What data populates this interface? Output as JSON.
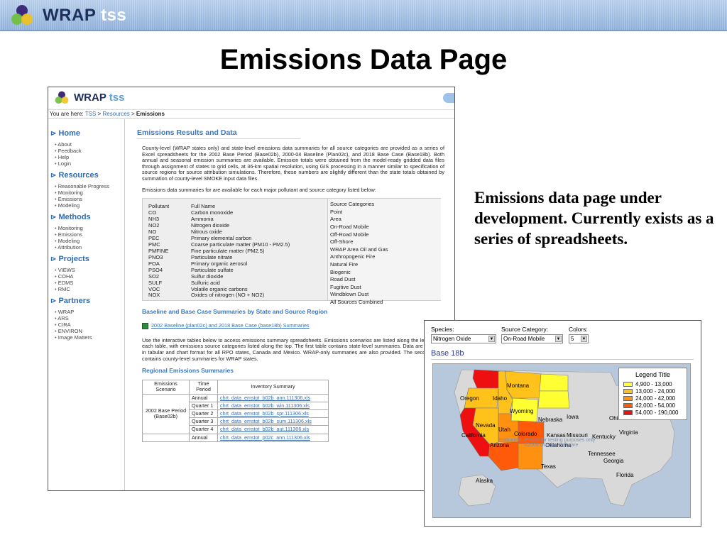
{
  "header": {
    "brand": "WRAP",
    "brand_suffix": "tss"
  },
  "slide": {
    "title": "Emissions Data Page",
    "caption": "Emissions data page under development.  Currently exists as a series of spreadsheets."
  },
  "shot1": {
    "brand": "WRAP",
    "brand_suffix": "tss",
    "breadcrumb": {
      "prefix": "You are here:",
      "items": [
        "TSS",
        "Resources"
      ],
      "current": "Emissions",
      "sep": ">"
    },
    "sidebar": [
      {
        "title": "Home",
        "items": [
          "About",
          "Feedback",
          "Help",
          "Login"
        ]
      },
      {
        "title": "Resources",
        "items": [
          "Reasonable Progress",
          "Monitoring",
          "Emissions",
          "Modeling"
        ]
      },
      {
        "title": "Methods",
        "items": [
          "Monitoring",
          "Emissions",
          "Modeling",
          "Attribution"
        ]
      },
      {
        "title": "Projects",
        "items": [
          "VIEWS",
          "COHA",
          "EDMS",
          "RMC"
        ]
      },
      {
        "title": "Partners",
        "items": [
          "WRAP",
          "ARS",
          "CIRA",
          "ENVIRON",
          "Image Matters"
        ]
      }
    ],
    "main": {
      "heading": "Emissions Results and Data",
      "para1": "County-level (WRAP states only) and state-level emissions data summaries for all source categories are provided as a series of Excel spreadsheets for the 2002 Base Period (Base02b), 2000-04 Baseline (Plan02c), and 2018 Base Case (Base18b). Both annual and seasonal emission summaries are available. Emission totals were obtained from the model-ready gridded data files through assignment of states to grid cells, at 36-km spatial resolution, using GIS processing in a manner similar to specification of source regions for source attribution simulations. Therefore, these numbers are slightly different than the state totals obtained by summation of county-level SMOKE input data files.",
      "para2": "Emissions data summaries for are available for each major pollutant and source category listed below:",
      "pollutant_header": "Pollutant",
      "fullname_header": "Full Name",
      "source_header": "Source Categories",
      "pollutants": [
        "CO",
        "NH3",
        "NO2",
        "NO",
        "PEC",
        "PMC",
        "PMFINE",
        "PNO3",
        "POA",
        "PSO4",
        "SO2",
        "SULF",
        "VOC",
        "NOX"
      ],
      "full_names": [
        "Carbon monoxide",
        "Ammonia",
        "Nitrogen dioxide",
        "Nitrous oxide",
        "Primary elemental carbon",
        "Coarse particulate matter (PM10 - PM2.5)",
        "Fine particulate matter (PM2.5)",
        "Particulate nitrate",
        "Primary organic aerosol",
        "Particulate sulfate",
        "Sulfur dioxide",
        "Sulfuric acid",
        "Volatile organic carbons",
        "Oxides of nitrogen (NO + NO2)"
      ],
      "sources": [
        "Point",
        "Area",
        "On-Road Mobile",
        "Off-Road Mobile",
        "Off-Shore",
        "WRAP Area Oil and Gas",
        "Anthropogenic Fire",
        "Natural Fire",
        "Biogenic",
        "Road Dust",
        "Fugitive Dust",
        "Windblown Dust",
        "All Sources Combined"
      ],
      "heading2": "Baseline and Base Case Summaries by State and Source Region",
      "xls_link": "2002 Baseline (plan02c) and 2018 Base Case (base18b) Summaries",
      "para3": "Use the interactive tables below to access emissions summary spreadsheets. Emissions scenarios are listed along the left side of each table, with emissions source categories listed along the top. The first table contains state-level summaries. Data are provided in tabular and chart format for all RPO states, Canada and Mexico. WRAP-only summaries are also provided. The second table contains county-level summaries for WRAP states.",
      "heading3": "Regional Emissions Summaries",
      "table": {
        "h1": "Emissions Scenario",
        "h2": "Time Period",
        "h3": "Inventory Summary",
        "scenario": "2002 Base Period (Base02b)",
        "rows": [
          {
            "period": "Annual",
            "file": "chrt_data_emstot_b02b_ann.111306.xls"
          },
          {
            "period": "Quarter 1",
            "file": "chrt_data_emstot_b02b_win.111306.xls"
          },
          {
            "period": "Quarter 2",
            "file": "chrt_data_emstot_b02b_spr.111306.xls"
          },
          {
            "period": "Quarter 3",
            "file": "chrt_data_emstot_b02b_sum.111306.xls"
          },
          {
            "period": "Quarter 4",
            "file": "chrt_data_emstot_b02b_aut.111306.xls"
          },
          {
            "period": "Annual",
            "file": "chrt_data_emstot_p02c_ann.111306.xls"
          }
        ]
      }
    }
  },
  "shot2": {
    "species_label": "Species:",
    "species_value": "Nitrogen Oxide",
    "source_label": "Source Category:",
    "source_value": "On-Road Mobile",
    "colors_label": "Colors:",
    "colors_value": "5",
    "map_title": "Base 18b",
    "legend_title": "Legend Title",
    "legend": [
      {
        "label": "4,900 - 13,000",
        "color": "#ffff33"
      },
      {
        "label": "13,000 - 24,000",
        "color": "#ffc21a"
      },
      {
        "label": "24,000 - 42,000",
        "color": "#ff9010"
      },
      {
        "label": "42,000 - 54,000",
        "color": "#ff5a0a"
      },
      {
        "label": "54,000 - 190,000",
        "color": "#ee1010"
      }
    ],
    "states": [
      "Oregon",
      "Idaho",
      "Montana",
      "Wyoming",
      "Nevada",
      "Utah",
      "Colorado",
      "California",
      "Arizona",
      "Nebraska",
      "Iowa",
      "Kansas",
      "Missouri",
      "Kentucky",
      "Oklahoma",
      "Tennessee",
      "Ohio",
      "Virginia",
      "Georgia",
      "Texas",
      "Florida",
      "Alaska"
    ],
    "watermark1": "Evaluation Version for testing purposes only",
    "watermark2": "©2006 Dundas Software"
  }
}
